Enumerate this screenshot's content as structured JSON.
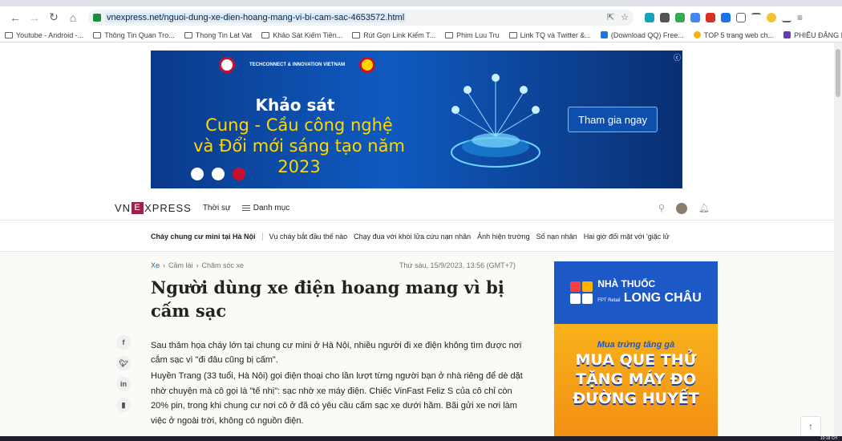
{
  "browser": {
    "url": "vnexpress.net/nguoi-dung-xe-dien-hoang-mang-vi-bi-cam-sac-4653572.html",
    "bookmarks": [
      {
        "label": "Youtube - Android -...",
        "type": "folder"
      },
      {
        "label": "Thông Tin Quan Tro...",
        "type": "folder"
      },
      {
        "label": "Thong Tin Lat Vat",
        "type": "folder"
      },
      {
        "label": "Khảo Sát Kiếm Tiền...",
        "type": "folder"
      },
      {
        "label": "Rút Gọn Link Kiếm T...",
        "type": "folder"
      },
      {
        "label": "Phim Luu Tru",
        "type": "folder"
      },
      {
        "label": "Link TQ và Twitter &...",
        "type": "folder"
      },
      {
        "label": "(Download QQ) Free...",
        "type": "site"
      },
      {
        "label": "TOP 5 trang web ch...",
        "type": "site"
      },
      {
        "label": "PHIẾU ĐĂNG KÝ TH...",
        "type": "site"
      }
    ]
  },
  "banner": {
    "title": "Khảo sát",
    "subtitle_line1": "Cung - Cầu công nghệ",
    "subtitle_line2": "và Đổi mới sáng tạo năm 2023",
    "cta": "Tham gia ngay",
    "org_logo": "TECHCONNECT & INNOVATION VIETNAM"
  },
  "header": {
    "logo_vn": "VN",
    "logo_e": "E",
    "logo_xpress": "XPRESS",
    "nav_thoisu": "Thời sự",
    "nav_danhmuc": "Danh mục"
  },
  "trending": [
    "Cháy chung cư mini tại Hà Nội",
    "Vụ cháy bắt đầu thế nào",
    "Chạy đua với khói lửa cứu nạn nhân",
    "Ảnh hiện trường",
    "Số nạn nhân",
    "Hai giờ đối mặt với 'giặc lử"
  ],
  "article": {
    "breadcrumb": [
      "Xe",
      "Cầm lái",
      "Chăm sóc xe"
    ],
    "date": "Thứ sáu, 15/9/2023, 13:56 (GMT+7)",
    "title": "Người dùng xe điện hoang mang vì bị cấm sạc",
    "description": "Sau thảm họa cháy lớn tại chung cư mini ở Hà Nội, nhiều người đi xe điện không tìm được nơi cắm sạc vì \"đi đâu cũng bị cấm\".",
    "paragraph": "Huyền Trang (33 tuổi, Hà Nội) gọi điện thoại cho lần lượt từng người bạn ở nhà riêng để dè dặt nhờ chuyện mà cô gọi là \"tế nhị\": sạc nhờ xe máy điện. Chiếc VinFast Feliz S của cô chỉ còn 20% pin, trong khi chung cư nơi cô ở đã có yêu cầu cấm sạc xe dưới hầm. Bãi gửi xe nơi làm việc ở ngoài trời, không có nguồn điện."
  },
  "side_ad": {
    "brand_small": "FPT Retail",
    "brand_line1": "NHÀ THUỐC",
    "brand_line2": "LONG CHÂU",
    "promo_line1": "Mua trứng tăng gà",
    "promo_line2": "MUA QUE THỬ",
    "promo_line3": "TẶNG MÁY ĐO",
    "promo_line4": "ĐƯỜNG HUYẾT"
  },
  "social": [
    "f",
    "t",
    "in",
    "bm"
  ],
  "taskbar": {
    "clock": "10:18 CH"
  }
}
